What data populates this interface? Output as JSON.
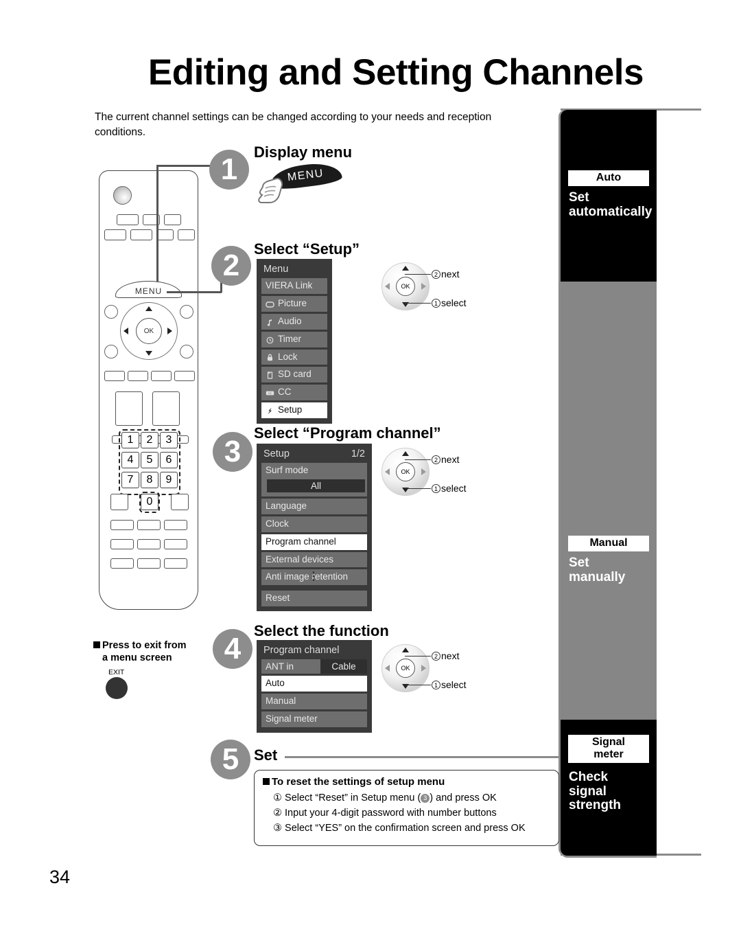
{
  "page": {
    "title": "Editing and Setting Channels",
    "intro": "The current channel settings can be changed according to your needs and reception conditions.",
    "page_number": "34"
  },
  "steps": [
    {
      "number": "1",
      "heading": "Display menu"
    },
    {
      "number": "2",
      "heading": "Select “Setup”"
    },
    {
      "number": "3",
      "heading": "Select “Program channel”"
    },
    {
      "number": "4",
      "heading": "Select the function"
    },
    {
      "number": "5",
      "heading": "Set"
    }
  ],
  "remote": {
    "menu_button_label": "MENU",
    "ok_label": "OK",
    "number_keys": [
      "1",
      "2",
      "3",
      "4",
      "5",
      "6",
      "7",
      "8",
      "9",
      "0"
    ]
  },
  "menu_banner": {
    "label": "MENU"
  },
  "osd_menu": {
    "title": "Menu",
    "items": [
      {
        "label": "VIERA Link",
        "icon": "",
        "selected": false
      },
      {
        "label": "Picture",
        "icon": "picture-icon",
        "selected": false
      },
      {
        "label": "Audio",
        "icon": "audio-note-icon",
        "selected": false
      },
      {
        "label": "Timer",
        "icon": "clock-icon",
        "selected": false
      },
      {
        "label": "Lock",
        "icon": "padlock-icon",
        "selected": false
      },
      {
        "label": "SD card",
        "icon": "sd-card-icon",
        "selected": false
      },
      {
        "label": "CC",
        "icon": "closed-caption-icon",
        "selected": false
      },
      {
        "label": "Setup",
        "icon": "setup-wrench-icon",
        "selected": true
      }
    ]
  },
  "osd_setup": {
    "title": "Setup",
    "page_indicator": "1/2",
    "surf_mode_label": "Surf mode",
    "surf_mode_value": "All",
    "items": [
      {
        "label": "Language",
        "selected": false
      },
      {
        "label": "Clock",
        "selected": false
      },
      {
        "label": "Program channel",
        "selected": true
      },
      {
        "label": "External devices",
        "selected": false
      },
      {
        "label": "Anti image retention",
        "selected": false
      }
    ],
    "reset_label": "Reset"
  },
  "osd_program_channel": {
    "title": "Program channel",
    "ant_in_label": "ANT in",
    "ant_in_value": "Cable",
    "items": [
      {
        "label": "Auto",
        "selected": true
      },
      {
        "label": "Manual",
        "selected": false
      },
      {
        "label": "Signal meter",
        "selected": false
      }
    ]
  },
  "dpad_callout": {
    "ok_label": "OK",
    "next_number": "2",
    "next_label": "next",
    "select_number": "1",
    "select_label": "select"
  },
  "exit_note": {
    "line1": "Press to exit from",
    "line2": "a menu screen",
    "button_label": "EXIT"
  },
  "reset_box": {
    "heading": "To reset the settings of setup menu",
    "steps": [
      {
        "num": "①",
        "text_before": "Select “Reset” in Setup menu (",
        "ref": "3",
        "text_after": ") and press OK"
      },
      {
        "num": "②",
        "text": "Input your 4-digit password with number buttons"
      },
      {
        "num": "③",
        "text": "Select “YES” on the confirmation screen and press OK"
      }
    ]
  },
  "sidebar": {
    "sections": [
      {
        "chip": "Auto",
        "desc_line1": "Set",
        "desc_line2": "automatically",
        "bg": "#000000"
      },
      {
        "chip": "Manual",
        "desc_line1": "Set",
        "desc_line2": "manually",
        "bg": "#868686"
      },
      {
        "chip_line1": "Signal",
        "chip_line2": "meter",
        "desc_line1": "Check",
        "desc_line2": "signal",
        "desc_line3": "strength",
        "bg": "#000000"
      }
    ]
  }
}
